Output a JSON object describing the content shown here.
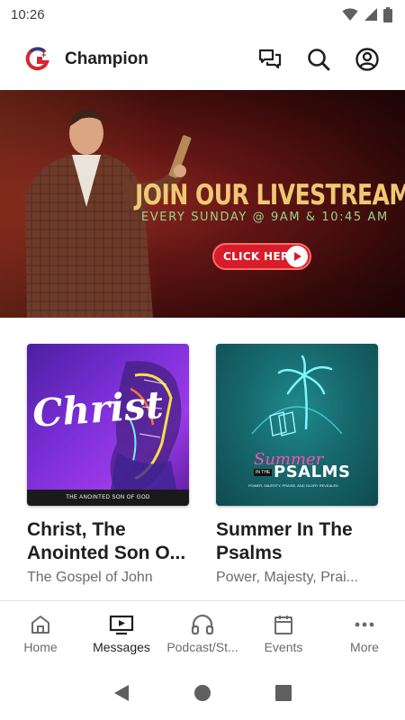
{
  "status_bar": {
    "time": "10:26",
    "icons": [
      "wifi-icon",
      "cellular-signal-icon",
      "battery-icon"
    ]
  },
  "app_bar": {
    "title": "Champion",
    "logo": "champion-logo",
    "actions": [
      "chat-icon",
      "search-icon",
      "account-icon"
    ]
  },
  "hero": {
    "headline": "JOIN OUR LIVESTREAM SERVICE",
    "subhead": "EVERY SUNDAY @ 9AM & 10:45 AM",
    "cta_label": "CLICK HERE"
  },
  "cards": [
    {
      "title": "Christ, The Anointed Son O...",
      "subtitle": "The Gospel of John",
      "art_word": "Christ",
      "art_caption": "THE ANOINTED SON OF GOD"
    },
    {
      "title": "Summer In The Psalms",
      "subtitle": "Power, Majesty, Prai...",
      "art_word": "Summer",
      "art_word2": "PSALMS",
      "art_small": "IN THE",
      "art_caption": "POWER, MAJESTY, PRAISE, AND GLORY REVEALED"
    }
  ],
  "bottom_nav": {
    "active": "Messages",
    "items": [
      {
        "label": "Home",
        "icon": "home-icon"
      },
      {
        "label": "Messages",
        "icon": "tv-play-icon"
      },
      {
        "label": "Podcast/St...",
        "icon": "headphones-icon"
      },
      {
        "label": "Events",
        "icon": "calendar-icon"
      },
      {
        "label": "More",
        "icon": "more-dots-icon"
      }
    ]
  },
  "colors": {
    "hero_headline": "#f0c873",
    "hero_subhead": "#9bd38a",
    "cta": "#d71d2a",
    "active_nav": "#1f1f1f",
    "inactive_nav": "#6b6b6b"
  }
}
